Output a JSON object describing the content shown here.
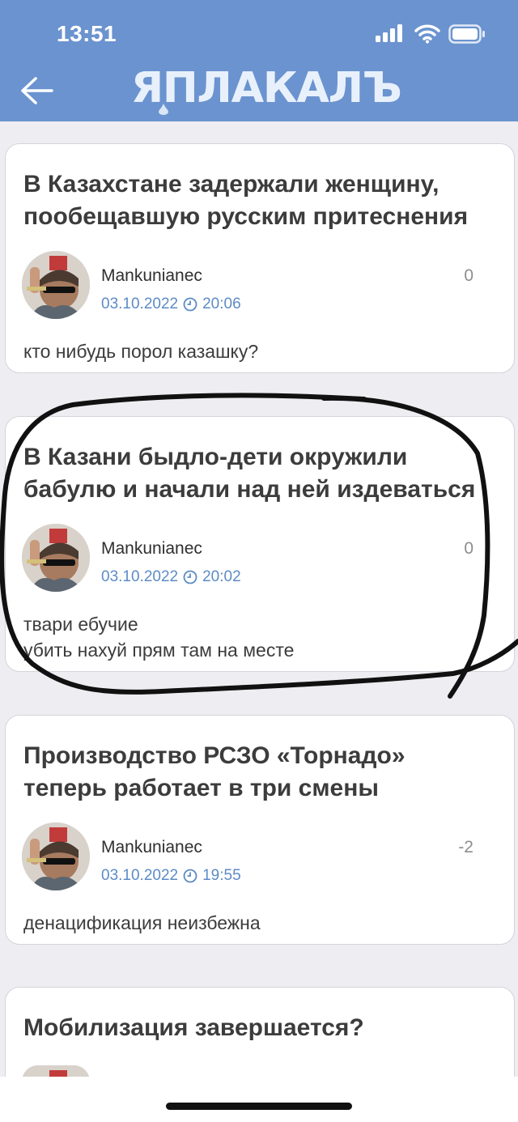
{
  "status_bar": {
    "time": "13:51"
  },
  "header": {
    "logo": "ЯПЛАКАЛЪ"
  },
  "posts": [
    {
      "title": "В Казахстане задержали женщину,\nпообещавшую русским притеснения",
      "author": "Mankunianec",
      "date": "03.10.2022",
      "time": "20:06",
      "score": "0",
      "comment": "кто нибудь порол казашку?"
    },
    {
      "title": "В Казани быдло-дети окружили\nбабулю и начали над ней издеваться",
      "author": "Mankunianec",
      "date": "03.10.2022",
      "time": "20:02",
      "score": "0",
      "comment": "твари ебучие\nубить нахуй прям там на месте"
    },
    {
      "title": "Производство РСЗО «Торнадо»\nтеперь работает в три смены",
      "author": "Mankunianec",
      "date": "03.10.2022",
      "time": "19:55",
      "score": "-2",
      "comment": "денацификация неизбежна"
    },
    {
      "title": "Мобилизация завершается?"
    }
  ],
  "icons": {
    "back": "arrow-left-icon",
    "clock": "clock-icon",
    "signal": "signal-icon",
    "wifi": "wifi-icon",
    "battery": "battery-icon"
  },
  "colors": {
    "header": "#6b93cf",
    "meta": "#5d8bc6",
    "background": "#ededf2"
  }
}
